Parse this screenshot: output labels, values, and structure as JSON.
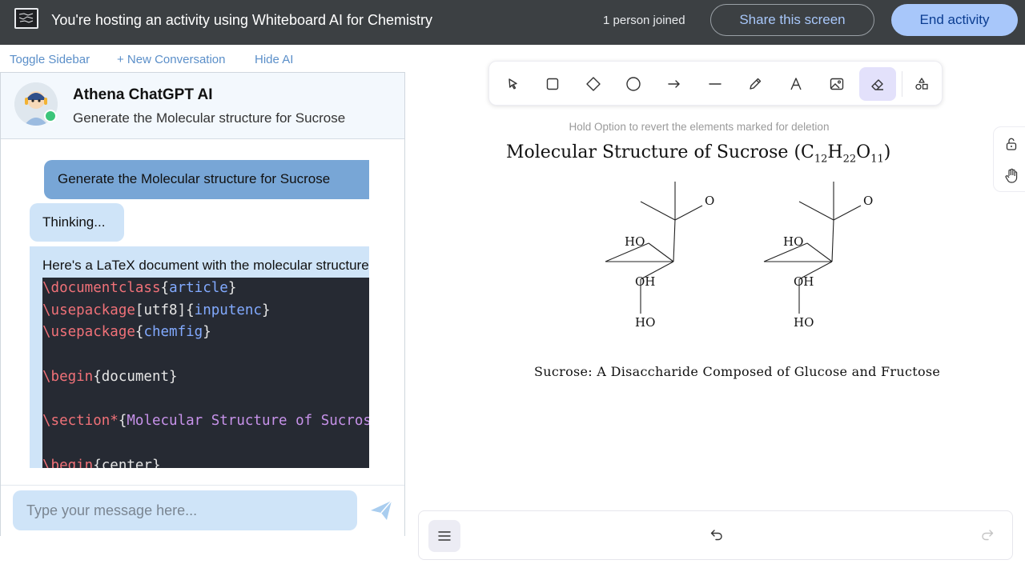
{
  "topbar": {
    "host_text": "You're hosting an activity using Whiteboard AI for Chemistry",
    "joined_text": "1 person joined",
    "share_label": "Share this screen",
    "end_label": "End activity"
  },
  "sidebar_links": {
    "toggle_sidebar": "Toggle Sidebar",
    "new_conversation": "+ New Conversation",
    "hide_ai": "Hide AI"
  },
  "chat": {
    "bot_name": "Athena ChatGPT AI",
    "bot_subtitle": "Generate the Molecular structure for Sucrose",
    "messages": [
      {
        "role": "user",
        "text": "Generate the Molecular structure for Sucrose"
      },
      {
        "role": "assistant",
        "text": "Thinking..."
      },
      {
        "role": "assistant",
        "text": "Here's a LaTeX document with the molecular structure"
      }
    ],
    "code_lines": [
      {
        "cmd": "\\documentclass",
        "p1": "{",
        "arg": "article",
        "p2": "}"
      },
      {
        "cmd": "\\usepackage",
        "p1": "[utf8]{",
        "arg": "inputenc",
        "p2": "}"
      },
      {
        "cmd": "\\usepackage",
        "p1": "{",
        "arg": "chemfig",
        "p2": "}"
      },
      {
        "cmd": "",
        "p1": "",
        "arg": "",
        "p2": ""
      },
      {
        "cmd": "\\begin",
        "p1": "{document}",
        "arg": "",
        "p2": ""
      },
      {
        "cmd": "",
        "p1": "",
        "arg": "",
        "p2": ""
      },
      {
        "cmd": "\\section*",
        "p1": "{",
        "arg": "Molecular Structure of Sucrose",
        "p2": "}"
      },
      {
        "cmd": "",
        "p1": "",
        "arg": "",
        "p2": ""
      },
      {
        "cmd": "\\begin",
        "p1": "{center}",
        "arg": "",
        "p2": ""
      }
    ],
    "input_placeholder": "Type your message here..."
  },
  "toolbar": {
    "tools": [
      "selection-icon",
      "rectangle-icon",
      "diamond-icon",
      "ellipse-icon",
      "arrow-icon",
      "line-icon",
      "pencil-icon",
      "text-icon",
      "image-icon",
      "eraser-icon",
      "library-icon"
    ],
    "active_tool": "eraser-icon"
  },
  "canvas": {
    "hint": "Hold Option to revert the elements marked for deletion",
    "title_main": "Molecular Structure of Sucrose (C",
    "title_c_sub": "12",
    "title_h": "H",
    "title_h_sub": "22",
    "title_o": "O",
    "title_o_sub": "11",
    "title_end": ")",
    "label_o": "O",
    "label_ho": "HO",
    "label_oh": "OH",
    "caption": "Sucrose: A Disaccharide Composed of Glucose and Fructose"
  },
  "colors": {
    "topbar_bg": "#3c4043",
    "accent_blue": "#a8c7fa",
    "user_bubble": "#78a6d6",
    "assistant_bubble": "#cfe4f8",
    "code_bg": "#262a33",
    "active_tool_bg": "#e3e1fb",
    "online_green": "#3cc57a"
  }
}
